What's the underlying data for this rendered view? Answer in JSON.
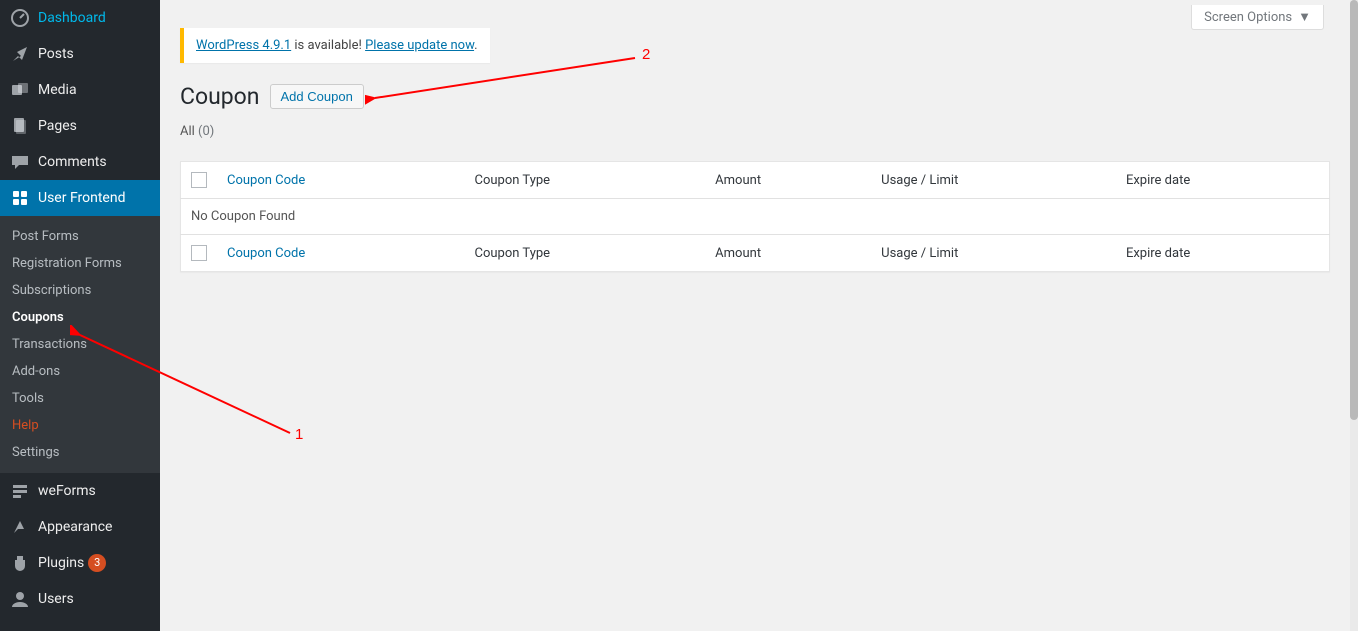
{
  "sidebar": {
    "items": [
      {
        "id": "dashboard",
        "label": "Dashboard"
      },
      {
        "id": "posts",
        "label": "Posts"
      },
      {
        "id": "media",
        "label": "Media"
      },
      {
        "id": "pages",
        "label": "Pages"
      },
      {
        "id": "comments",
        "label": "Comments"
      },
      {
        "id": "user-frontend",
        "label": "User Frontend"
      },
      {
        "id": "weforms",
        "label": "weForms"
      },
      {
        "id": "appearance",
        "label": "Appearance"
      },
      {
        "id": "plugins",
        "label": "Plugins",
        "badge": "3"
      },
      {
        "id": "users",
        "label": "Users"
      }
    ],
    "submenu": [
      {
        "id": "post-forms",
        "label": "Post Forms"
      },
      {
        "id": "registration-forms",
        "label": "Registration Forms"
      },
      {
        "id": "subscriptions",
        "label": "Subscriptions"
      },
      {
        "id": "coupons",
        "label": "Coupons"
      },
      {
        "id": "transactions",
        "label": "Transactions"
      },
      {
        "id": "addons",
        "label": "Add-ons"
      },
      {
        "id": "tools",
        "label": "Tools"
      },
      {
        "id": "help",
        "label": "Help"
      },
      {
        "id": "settings",
        "label": "Settings"
      }
    ]
  },
  "screen_options_label": "Screen Options",
  "notice": {
    "link1": "WordPress 4.9.1",
    "mid": " is available! ",
    "link2": "Please update now",
    "tail": "."
  },
  "page": {
    "title": "Coupon",
    "add_button": "Add Coupon",
    "filter_all": "All",
    "filter_count": "(0)",
    "empty": "No Coupon Found"
  },
  "table": {
    "col_code": "Coupon Code",
    "col_type": "Coupon Type",
    "col_amount": "Amount",
    "col_usage": "Usage / Limit",
    "col_expire": "Expire date"
  },
  "annotations": {
    "label1": "1",
    "label2": "2"
  }
}
